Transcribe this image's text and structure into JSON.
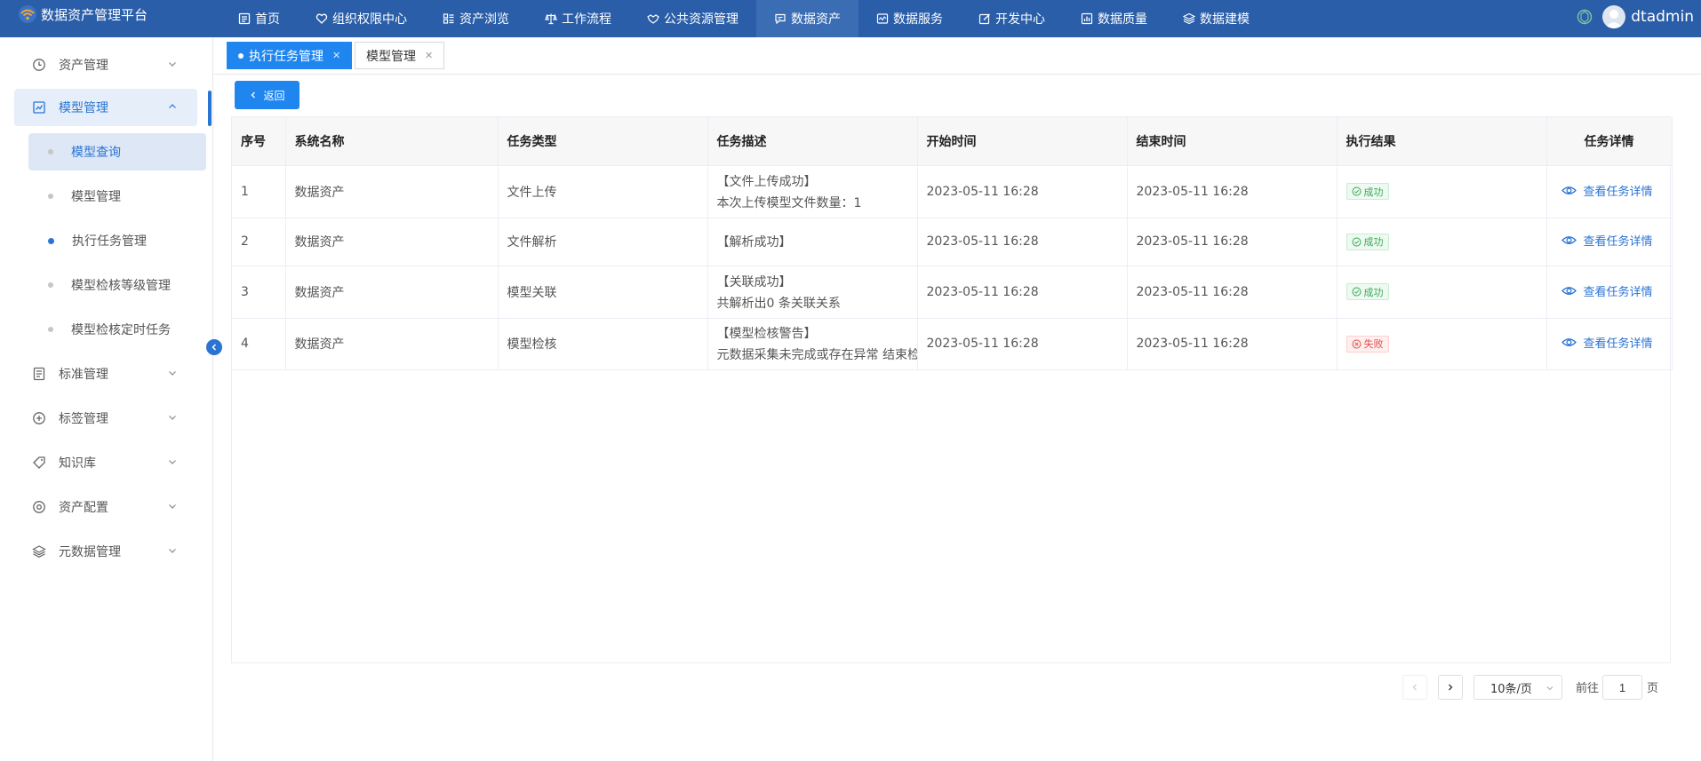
{
  "app": {
    "title": "数据资产管理平台",
    "username": "dtadmin"
  },
  "nav": [
    {
      "label": "首页",
      "icon": "home-icon"
    },
    {
      "label": "组织权限中心",
      "icon": "shield-heart-icon"
    },
    {
      "label": "资产浏览",
      "icon": "list-icon"
    },
    {
      "label": "工作流程",
      "icon": "scale-icon"
    },
    {
      "label": "公共资源管理",
      "icon": "handshake-icon"
    },
    {
      "label": "数据资产",
      "icon": "chat-icon",
      "active": true
    },
    {
      "label": "数据服务",
      "icon": "monitor-icon"
    },
    {
      "label": "开发中心",
      "icon": "edit-icon"
    },
    {
      "label": "数据质量",
      "icon": "bar-chart-icon"
    },
    {
      "label": "数据建模",
      "icon": "layers-icon"
    }
  ],
  "sidebar": {
    "items": [
      {
        "label": "资产管理"
      },
      {
        "label": "模型管理",
        "open": true
      },
      {
        "label": "标准管理"
      },
      {
        "label": "标签管理"
      },
      {
        "label": "知识库"
      },
      {
        "label": "资产配置"
      },
      {
        "label": "元数据管理"
      }
    ],
    "sub_items": [
      {
        "label": "模型查询",
        "highlight": true
      },
      {
        "label": "模型管理"
      },
      {
        "label": "执行任务管理",
        "current": true
      },
      {
        "label": "模型检核等级管理"
      },
      {
        "label": "模型检核定时任务"
      }
    ]
  },
  "tabs": [
    {
      "label": "执行任务管理",
      "active": true
    },
    {
      "label": "模型管理"
    }
  ],
  "back_label": "返回",
  "table": {
    "headers": [
      "序号",
      "系统名称",
      "任务类型",
      "任务描述",
      "开始时间",
      "结束时间",
      "执行结果",
      "任务详情"
    ],
    "rows": [
      {
        "idx": "1",
        "system": "数据资产",
        "type": "文件上传",
        "desc1": "【文件上传成功】",
        "desc2": "本次上传模型文件数量：1",
        "start": "2023-05-11 16:28",
        "end": "2023-05-11 16:28",
        "result": "成功",
        "status": "ok",
        "detail": "查看任务详情"
      },
      {
        "idx": "2",
        "system": "数据资产",
        "type": "文件解析",
        "desc1": "【解析成功】",
        "desc2": "",
        "start": "2023-05-11 16:28",
        "end": "2023-05-11 16:28",
        "result": "成功",
        "status": "ok",
        "detail": "查看任务详情"
      },
      {
        "idx": "3",
        "system": "数据资产",
        "type": "模型关联",
        "desc1": "【关联成功】",
        "desc2": "共解析出0 条关联关系",
        "start": "2023-05-11 16:28",
        "end": "2023-05-11 16:28",
        "result": "成功",
        "status": "ok",
        "detail": "查看任务详情"
      },
      {
        "idx": "4",
        "system": "数据资产",
        "type": "模型检核",
        "desc1": "【模型检核警告】",
        "desc2": "元数据采集未完成或存在异常 结束检",
        "start": "2023-05-11 16:28",
        "end": "2023-05-11 16:28",
        "result": "失败",
        "status": "fail",
        "detail": "查看任务详情"
      }
    ]
  },
  "pagination": {
    "page_size": "10条/页",
    "goto_label": "前往",
    "page": "1",
    "page_suffix": "页"
  },
  "colors": {
    "topbar": "#2a5ea9",
    "accent": "#1f86f0",
    "success": "#3aa857",
    "danger": "#e04c4c"
  }
}
